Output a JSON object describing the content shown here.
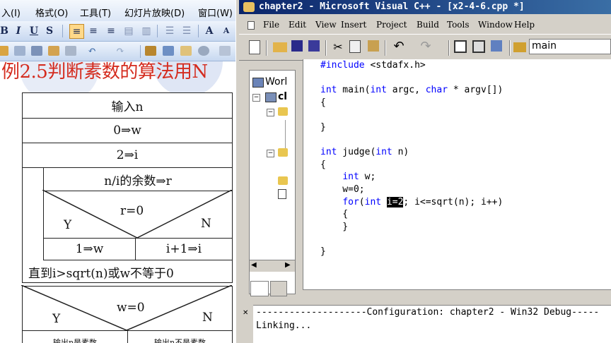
{
  "ppt": {
    "menu": [
      "入(I)",
      "格式(O)",
      "工具(T)",
      "幻灯片放映(D)",
      "窗口(W)"
    ],
    "format_buttons": [
      "B",
      "I",
      "U",
      "S"
    ],
    "slide_title": "例2.5判断素数的算法用N",
    "flowchart": {
      "input": "输入n",
      "assign_w": "0⇒w",
      "assign_i": "2⇒i",
      "remainder": "n/i的余数⇒r",
      "condition": "r=0",
      "yes": "Y",
      "no": "N",
      "yes_branch": "1⇒w",
      "no_branch": "i+1⇒i",
      "loop_until": "直到i>sqrt(n)或w不等于0",
      "condition2": "w=0",
      "yes2": "Y",
      "no2": "N",
      "out_yes": "输出n是素数",
      "out_no": "输出n不是素数"
    }
  },
  "vc": {
    "title": "chapter2 - Microsoft Visual C++ - [x2-4-6.cpp *]",
    "menu": [
      "File",
      "Edit",
      "View",
      "Insert",
      "Project",
      "Build",
      "Tools",
      "Window",
      "Help"
    ],
    "combo_value": "main",
    "workspace_label": "Worl",
    "workspace_sub": "cl",
    "code_lines": [
      "#include <stdafx.h>",
      "",
      "int main(int argc, char * argv[])",
      "{",
      "",
      "}",
      "",
      "int judge(int n)",
      "{",
      "    int w;",
      "    w=0;",
      "    for(int i=2; i<=sqrt(n); i++)",
      "    {",
      "    }",
      "",
      "}"
    ],
    "output_lines": [
      "--------------------Configuration: chapter2 - Win32 Debug-----",
      "Linking..."
    ]
  },
  "colors": {
    "slide_title": "#d42c1f",
    "vc_titlebar": "#0a246a",
    "keyword": "#0000ff"
  }
}
